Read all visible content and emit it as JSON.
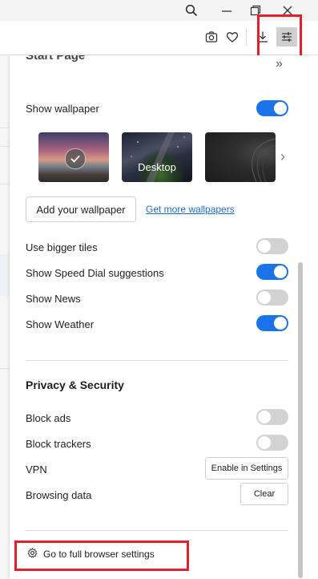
{
  "window": {
    "search_icon": "search-icon",
    "minimize_icon": "minimize-icon",
    "restore_icon": "restore-icon",
    "close_icon": "close-icon"
  },
  "toolbar": {
    "icons": [
      "camera-icon",
      "heart-icon",
      "download-icon",
      "easy-setup-icon"
    ]
  },
  "panel": {
    "collapse_glyph": "»",
    "start_page_heading": "Start Page",
    "show_wallpaper_label": "Show wallpaper",
    "show_wallpaper_on": true,
    "wallpapers": [
      {
        "caption": "",
        "selected": true
      },
      {
        "caption": "Desktop",
        "selected": false
      },
      {
        "caption": "",
        "selected": false
      }
    ],
    "next_glyph": "›",
    "add_wallpaper_label": "Add your wallpaper",
    "more_wallpapers_link": "Get more wallpapers",
    "toggles": [
      {
        "label": "Use bigger tiles",
        "on": false
      },
      {
        "label": "Show Speed Dial suggestions",
        "on": true
      },
      {
        "label": "Show News",
        "on": false
      },
      {
        "label": "Show Weather",
        "on": true
      }
    ],
    "privacy_heading": "Privacy & Security",
    "privacy_toggles": [
      {
        "label": "Block ads",
        "on": false
      },
      {
        "label": "Block trackers",
        "on": false
      }
    ],
    "vpn_label": "VPN",
    "vpn_button": "Enable in Settings",
    "browsing_data_label": "Browsing data",
    "clear_button": "Clear",
    "full_settings_link": "Go to full browser settings"
  },
  "colors": {
    "accent": "#1a73e8",
    "highlight": "#e0202a"
  }
}
